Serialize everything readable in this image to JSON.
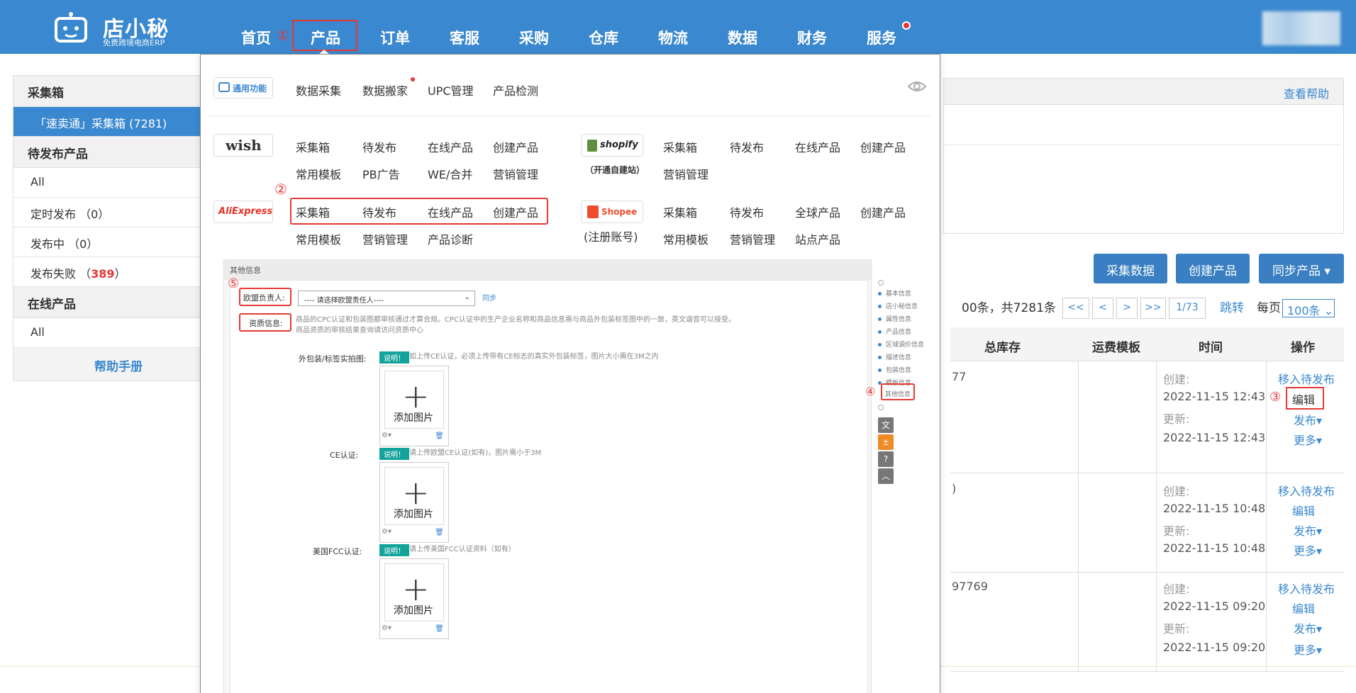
{
  "header": {
    "logo_name": "店小秘",
    "logo_sub": "免费跨境电商ERP",
    "nav": [
      {
        "label": "首页"
      },
      {
        "label": "产品"
      },
      {
        "label": "订单"
      },
      {
        "label": "客服"
      },
      {
        "label": "采购"
      },
      {
        "label": "仓库"
      },
      {
        "label": "物流"
      },
      {
        "label": "数据"
      },
      {
        "label": "财务"
      },
      {
        "label": "服务"
      }
    ]
  },
  "annotations": {
    "n1": "①",
    "n2": "②",
    "n3": "③",
    "n4": "④",
    "n5": "⑤"
  },
  "sidebar": {
    "group1_title": "采集箱",
    "active_item": "「速卖通」采集箱 (7281)",
    "group2_title": "待发布产品",
    "items": [
      {
        "label": "All"
      },
      {
        "label": "定时发布 （0）"
      },
      {
        "label": "发布中 （0）"
      }
    ],
    "failed_label": "发布失败 （",
    "failed_count": "389",
    "failed_close": "）",
    "group3_title": "在线产品",
    "online_all": "All",
    "help": "帮助手册"
  },
  "main": {
    "help_link": "查看帮助",
    "buttons": {
      "collect": "采集数据",
      "create": "创建产品",
      "sync": "同步产品 ▾"
    },
    "pager": {
      "summary": "00条，共7281条",
      "first": "<<",
      "prev": "<",
      "next": ">",
      "last": ">>",
      "page": "1/73",
      "jump": "跳转",
      "per_page_label": "每页",
      "per_page_value": "100条"
    },
    "columns": {
      "stock": "总库存",
      "template": "运费模板",
      "time": "时间",
      "ops": "操作"
    },
    "rows": [
      {
        "id_frag": "77",
        "created_label": "创建:",
        "created": "2022-11-15 12:43",
        "updated_label": "更新:",
        "updated": "2022-11-15 12:43"
      },
      {
        "id_frag": ")",
        "created_label": "创建:",
        "created": "2022-11-15 10:48",
        "updated_label": "更新:",
        "updated": "2022-11-15 10:48"
      },
      {
        "id_frag": "97769",
        "created_label": "创建:",
        "created": "2022-11-15 09:20",
        "updated_label": "更新:",
        "updated": "2022-11-15 09:20"
      }
    ],
    "row_actions": {
      "move": "移入待发布",
      "edit": "编辑",
      "publish": "发布▾",
      "more": "更多▾"
    }
  },
  "dropdown": {
    "general_badge": "通用功能",
    "general_items": [
      "数据采集",
      "数据搬家",
      "UPC管理",
      "产品检测"
    ],
    "wish_badge": "wish",
    "wish_row1": [
      "采集箱",
      "待发布",
      "在线产品",
      "创建产品"
    ],
    "wish_row2": [
      "常用模板",
      "PB广告",
      "WE/合并",
      "营销管理"
    ],
    "shopify_badge": "shopify",
    "shopify_note": "（开通自建站）",
    "shopify_row1": [
      "采集箱",
      "待发布",
      "在线产品",
      "创建产品"
    ],
    "shopify_row2": [
      "营销管理"
    ],
    "ali_badge": "AliExpress",
    "ali_row1": [
      "采集箱",
      "待发布",
      "在线产品",
      "创建产品"
    ],
    "ali_row2": [
      "常用模板",
      "营销管理",
      "产品诊断"
    ],
    "shopee_badge": "Shopee",
    "shopee_note": "(注册账号)",
    "shopee_row1": [
      "采集箱",
      "待发布",
      "全球产品",
      "创建产品"
    ],
    "shopee_row2": [
      "常用模板",
      "营销管理",
      "站点产品"
    ]
  },
  "form": {
    "section_title": "其他信息",
    "eu_label": "欧盟负责人:",
    "eu_select": "---- 请选择欧盟责任人----",
    "sync": "同步",
    "qual_label": "资质信息:",
    "qual_note": "商品的CPC认证和包装图都审核通过才算合规。CPC认证中的生产企业名称和商品信息需与商品外包装标签图中的一致，英文谐音可以接受。商品资质的审核结果查询请访问资质中心",
    "pkg_label": "外包装/标签实拍图:",
    "tag": "说明！",
    "pkg_note": "如上传CE认证，必须上传带有CE标志的真实外包装标签，图片大小需在3M之内",
    "ce_label": "CE认证:",
    "ce_note": "请上传欧盟CE认证(如有)，图片需小于3M",
    "fcc_label": "美国FCC认证:",
    "fcc_note": "请上传美国FCC认证资料（如有）",
    "add_image": "添加图片",
    "side_nav": [
      "基本信息",
      "店小秘信息",
      "属性信息",
      "产品信息",
      "区域调价信息",
      "描述信息",
      "包装信息",
      "模板信息",
      "其他信息"
    ]
  }
}
